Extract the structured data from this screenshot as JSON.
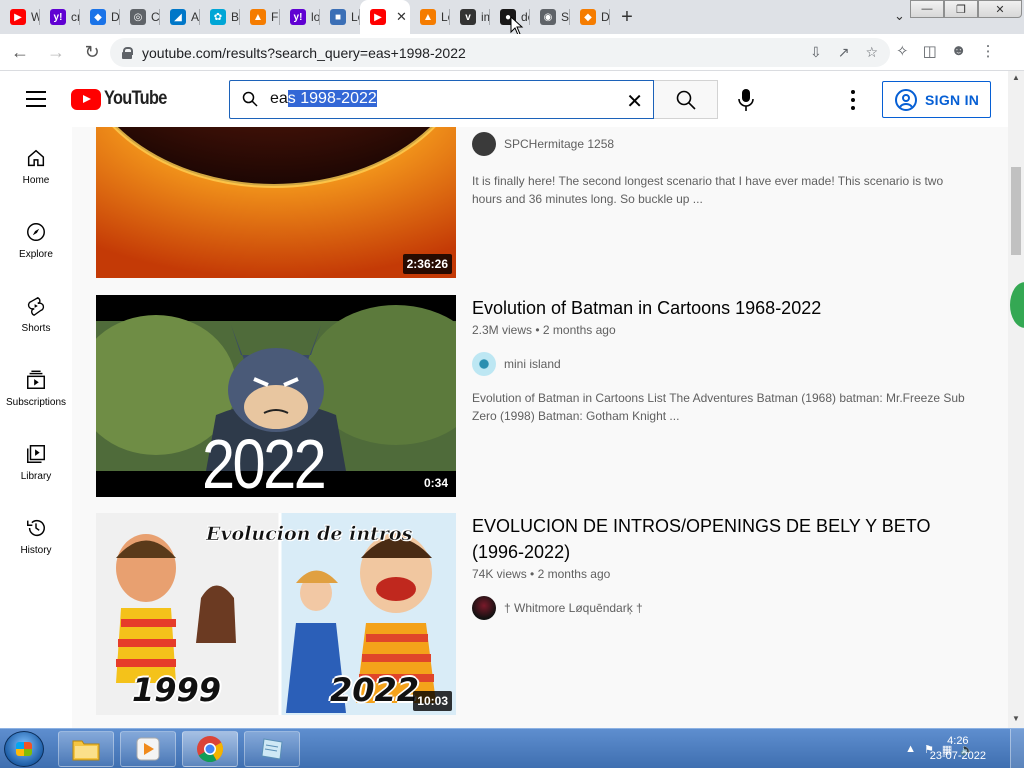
{
  "browser": {
    "tabs": [
      {
        "label": "Wi",
        "fav_color": "#ff0000",
        "fav_text": "▶"
      },
      {
        "label": "cry",
        "fav_color": "#6001d2",
        "fav_text": "y!"
      },
      {
        "label": "Dc",
        "fav_color": "#1a73e8",
        "fav_text": "◆"
      },
      {
        "label": "Cr",
        "fav_color": "#5f6368",
        "fav_text": "◎"
      },
      {
        "label": "As",
        "fav_color": "#0077c8",
        "fav_text": "◢"
      },
      {
        "label": "Bu",
        "fav_color": "#00a6d6",
        "fav_text": "✿"
      },
      {
        "label": "Fre",
        "fav_color": "#f57c00",
        "fav_text": "▲"
      },
      {
        "label": "lo",
        "fav_color": "#6001d2",
        "fav_text": "y!"
      },
      {
        "label": "Lo",
        "fav_color": "#3b6fb6",
        "fav_text": "■"
      },
      {
        "label": "",
        "fav_color": "#ff0000",
        "fav_text": "▶",
        "active": true
      },
      {
        "label": "Lo",
        "fav_color": "#f57c00",
        "fav_text": "▲"
      },
      {
        "label": "im",
        "fav_color": "#333333",
        "fav_text": "v"
      },
      {
        "label": "de",
        "fav_color": "#181717",
        "fav_text": "●"
      },
      {
        "label": "Sit",
        "fav_color": "#5f6368",
        "fav_text": "◉"
      },
      {
        "label": "De",
        "fav_color": "#f57c00",
        "fav_text": "◆"
      }
    ],
    "new_tab_label": "+",
    "url": "youtube.com/results?search_query=eas+1998-2022"
  },
  "youtube": {
    "logo_text": "YouTube",
    "search_value_unselected": "ea",
    "search_value_selected": "s 1998-2022",
    "signin_label": "SIGN IN",
    "sidebar": [
      {
        "label": "Home",
        "icon": "home-icon"
      },
      {
        "label": "Explore",
        "icon": "compass-icon"
      },
      {
        "label": "Shorts",
        "icon": "shorts-icon"
      },
      {
        "label": "Subscriptions",
        "icon": "subscriptions-icon"
      },
      {
        "label": "Library",
        "icon": "library-icon"
      },
      {
        "label": "History",
        "icon": "history-icon"
      }
    ],
    "videos": [
      {
        "title": "",
        "views": "",
        "ago": "",
        "channel": "SPCHermitage 1258",
        "desc": "It is finally here! The second longest scenario that I have ever made! This scenario is two hours and 36 minutes long. So buckle up ...",
        "duration": "2:36:26"
      },
      {
        "title": "Evolution of Batman in Cartoons 1968-2022",
        "views": "2.3M views",
        "ago": "2 months ago",
        "channel": "mini island",
        "desc": "Evolution of Batman in Cartoons List The Adventures Batman (1968) batman: Mr.Freeze Sub Zero (1998) Batman: Gotham Knight ...",
        "duration": "0:34",
        "thumb_text": "2022"
      },
      {
        "title": "EVOLUCION DE INTROS/OPENINGS DE BELY Y BETO (1996-2022)",
        "views": "74K views",
        "ago": "2 months ago",
        "channel": "† Whitmore Løquēndarķ †",
        "desc": "",
        "duration": "10:03",
        "thumb_caption": "Evolucion de intros",
        "thumb_left_year": "1999",
        "thumb_right_year": "2022"
      }
    ]
  },
  "taskbar": {
    "time": "4:26",
    "date": "23-07-2022"
  },
  "colors": {
    "yt_red": "#ff0000",
    "link_blue": "#065fd4",
    "selection": "#3367d6"
  }
}
